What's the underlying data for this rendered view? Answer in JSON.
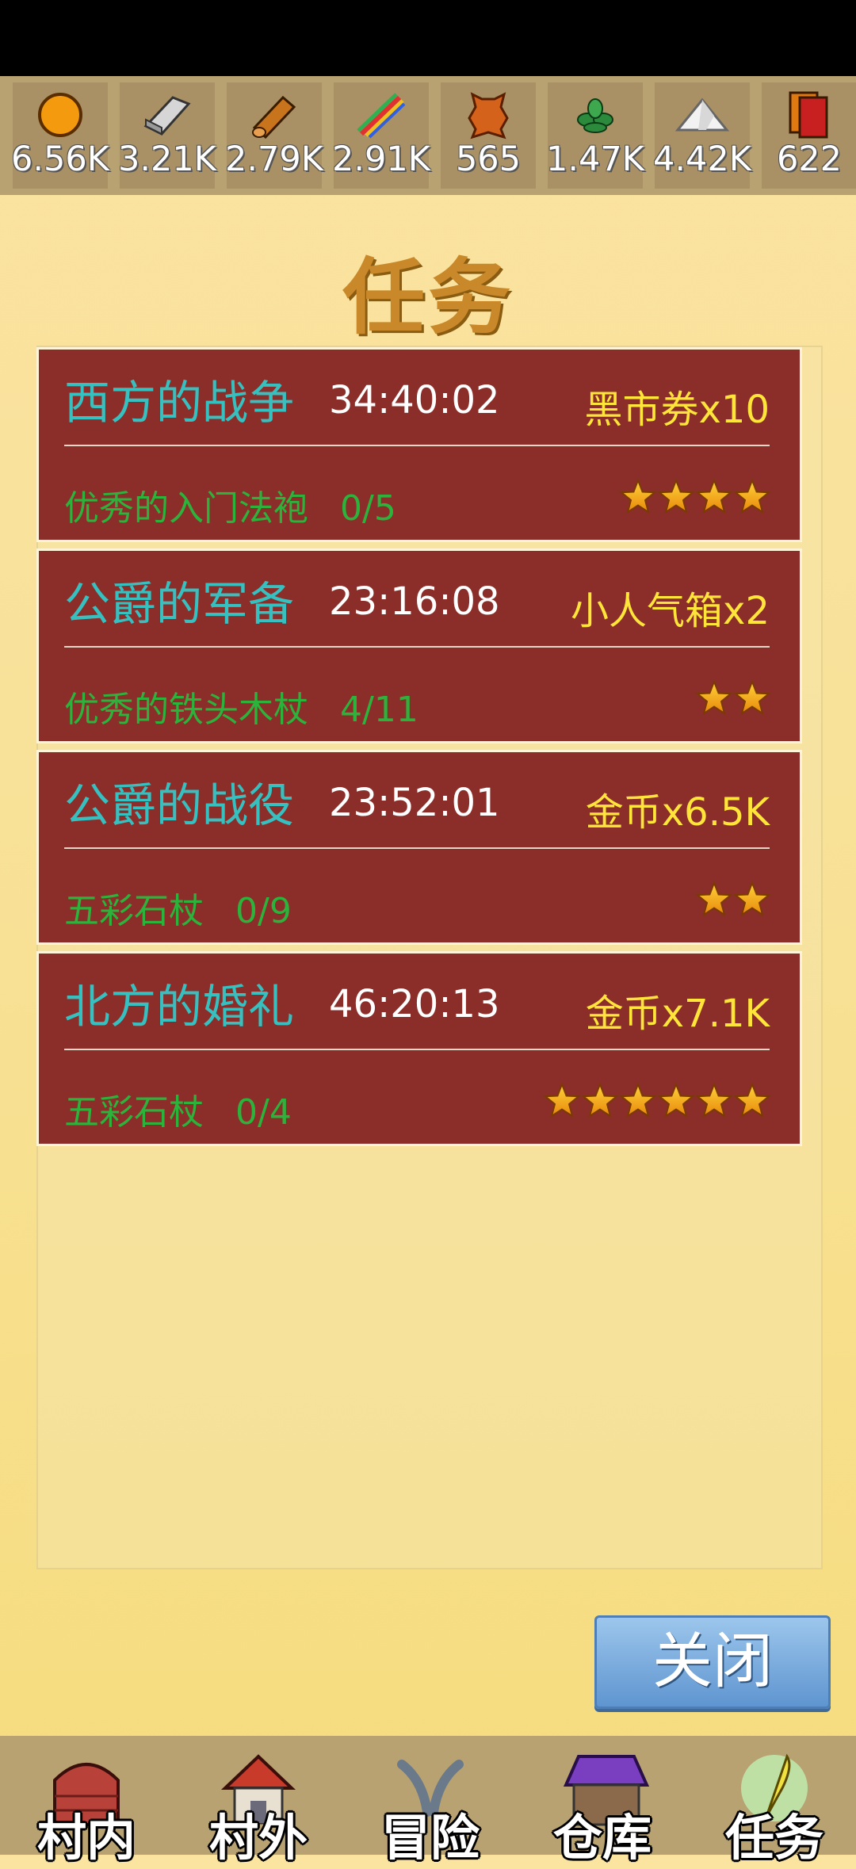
{
  "resources": [
    {
      "icon": "orange-coin-icon",
      "value": "6.56K"
    },
    {
      "icon": "iron-ingot-icon",
      "value": "3.21K"
    },
    {
      "icon": "wood-log-icon",
      "value": "2.79K"
    },
    {
      "icon": "rainbow-crayon-icon",
      "value": "2.91K"
    },
    {
      "icon": "leather-hide-icon",
      "value": "565"
    },
    {
      "icon": "herb-icon",
      "value": "1.47K"
    },
    {
      "icon": "salt-pile-icon",
      "value": "4.42K"
    },
    {
      "icon": "ticket-cards-icon",
      "value": "622"
    }
  ],
  "title": "任务",
  "quests": [
    {
      "name": "西方的战争",
      "time": "34:40:02",
      "reward": "黑市券x10",
      "item": "优秀的入门法袍",
      "progress": "0/5",
      "stars": 4
    },
    {
      "name": "公爵的军备",
      "time": "23:16:08",
      "reward": "小人气箱x2",
      "item": "优秀的铁头木杖",
      "progress": "4/11",
      "stars": 2
    },
    {
      "name": "公爵的战役",
      "time": "23:52:01",
      "reward": "金币x6.5K",
      "item": "五彩石杖",
      "progress": "0/9",
      "stars": 2
    },
    {
      "name": "北方的婚礼",
      "time": "46:20:13",
      "reward": "金币x7.1K",
      "item": "五彩石杖",
      "progress": "0/4",
      "stars": 6
    }
  ],
  "close_label": "关闭",
  "nav": [
    {
      "label": "村内",
      "icon": "red-barn-icon"
    },
    {
      "label": "村外",
      "icon": "cottage-icon"
    },
    {
      "label": "冒险",
      "icon": "crossed-swords-icon"
    },
    {
      "label": "仓库",
      "icon": "warehouse-icon"
    },
    {
      "label": "任务",
      "icon": "quill-icon"
    }
  ],
  "colors": {
    "quest_bg": "#8b2e2a",
    "quest_name": "#36c0c0",
    "reward": "#ffe53a",
    "item": "#2bb33c",
    "title": "#c9892a"
  }
}
